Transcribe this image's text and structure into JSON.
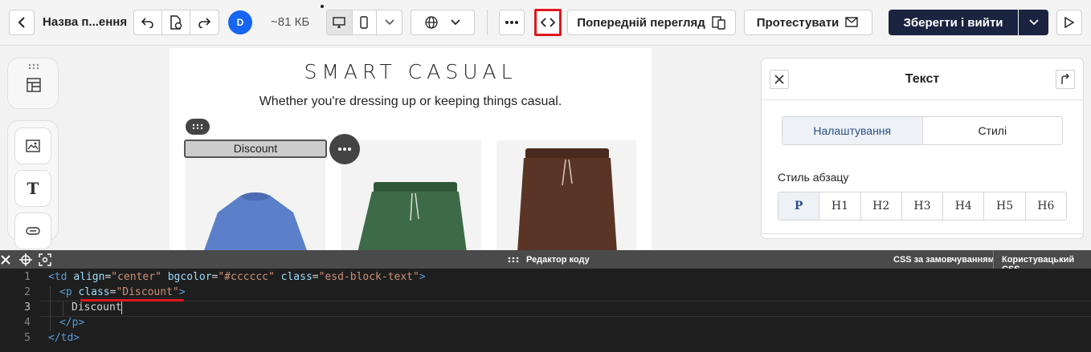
{
  "topbar": {
    "title": "Назва п...ення",
    "avatar": "D",
    "size": "~81 КБ",
    "preview_label": "Попередній перегляд",
    "test_label": "Протестувати",
    "save_label": "Зберегти і вийти"
  },
  "email": {
    "title": "SMART CASUAL",
    "subtitle": "Whether you're dressing up or keeping things casual.",
    "discount": "Discount",
    "products": [
      {
        "color": "#5b7fc8"
      },
      {
        "color": "#3e6b47"
      },
      {
        "color": "#5a3526"
      }
    ]
  },
  "panel": {
    "title": "Текст",
    "tabs": [
      "Налаштування",
      "Стилі"
    ],
    "paragraph_style_label": "Стиль абзацу",
    "styles": [
      "P",
      "H1",
      "H2",
      "H3",
      "H4",
      "H5",
      "H6"
    ]
  },
  "code_editor": {
    "title": "Редактор коду",
    "default_css": "CSS за замовчуванням",
    "custom_css": "Користувацький CSS",
    "line_numbers": [
      "1",
      "2",
      "3",
      "4",
      "5"
    ],
    "line1": {
      "open": "<td",
      "a1": "align",
      "v1": "\"center\"",
      "a2": "bgcolor",
      "v2": "\"#cccccc\"",
      "a3": "class",
      "v3": "\"esd-block-text\"",
      "close": ">"
    },
    "line2": {
      "open": "<p",
      "a1": "class",
      "v1": "\"Discount\"",
      "close": ">"
    },
    "line3": "Discount",
    "line4": "</p>",
    "line5": "</td>",
    "eq": "="
  },
  "colors": {
    "accent": "#1a2340",
    "highlight": "#e0161e",
    "avatar": "#1765f2"
  }
}
